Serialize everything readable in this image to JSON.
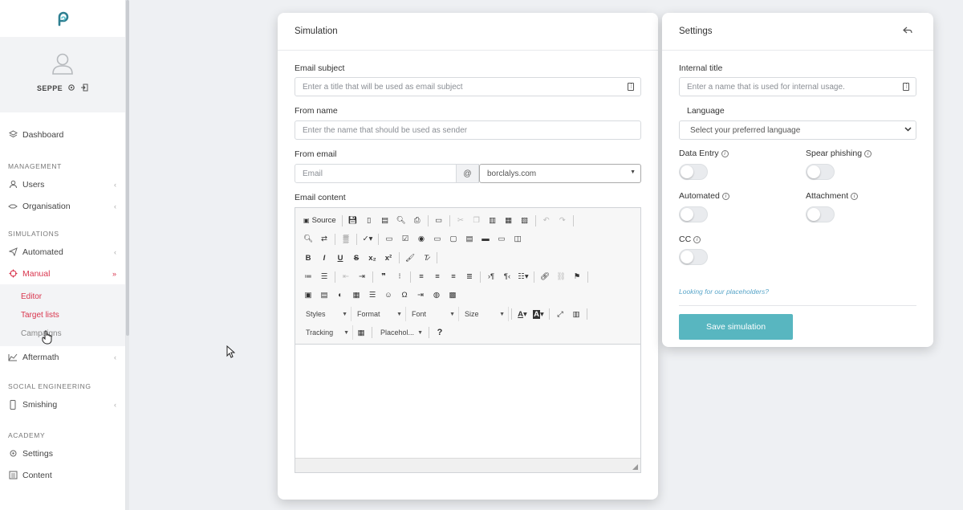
{
  "sidebar": {
    "user_name": "SEPPE",
    "items": {
      "dashboard": "Dashboard",
      "users": "Users",
      "organisation": "Organisation",
      "automated": "Automated",
      "manual": "Manual",
      "aftermath": "Aftermath",
      "smishing": "Smishing",
      "settings": "Settings",
      "content": "Content"
    },
    "sections": {
      "management": "MANAGEMENT",
      "simulations": "SIMULATIONS",
      "social_engineering": "SOCIAL ENGINEERING",
      "academy": "ACADEMY"
    },
    "submenu": {
      "editor": "Editor",
      "target_lists": "Target lists",
      "campaigns": "Campaigns"
    }
  },
  "simulation": {
    "title": "Simulation",
    "email_subject_label": "Email subject",
    "email_subject_placeholder": "Enter a title that will be used as email subject",
    "from_name_label": "From name",
    "from_name_placeholder": "Enter the name that should be used as sender",
    "from_email_label": "From email",
    "from_email_placeholder": "Email",
    "at_symbol": "@",
    "domain_value": "borclalys.com",
    "email_content_label": "Email content",
    "editor": {
      "source_label": "Source",
      "styles": "Styles",
      "format": "Format",
      "font": "Font",
      "size": "Size",
      "tracking": "Tracking",
      "placeholders": "Placehol...",
      "help": "?"
    }
  },
  "settings": {
    "title": "Settings",
    "internal_title_label": "Internal title",
    "internal_title_placeholder": "Enter a name that is used for internal usage.",
    "language_label": "Language",
    "language_placeholder": "Select your preferred language",
    "toggles": {
      "data_entry": "Data Entry",
      "spear_phishing": "Spear phishing",
      "automated": "Automated",
      "attachment": "Attachment",
      "cc": "CC"
    },
    "placeholders_link": "Looking for our placeholders?",
    "save_button": "Save simulation"
  },
  "colors": {
    "accent": "#58b6c0",
    "active": "#d9354d"
  }
}
